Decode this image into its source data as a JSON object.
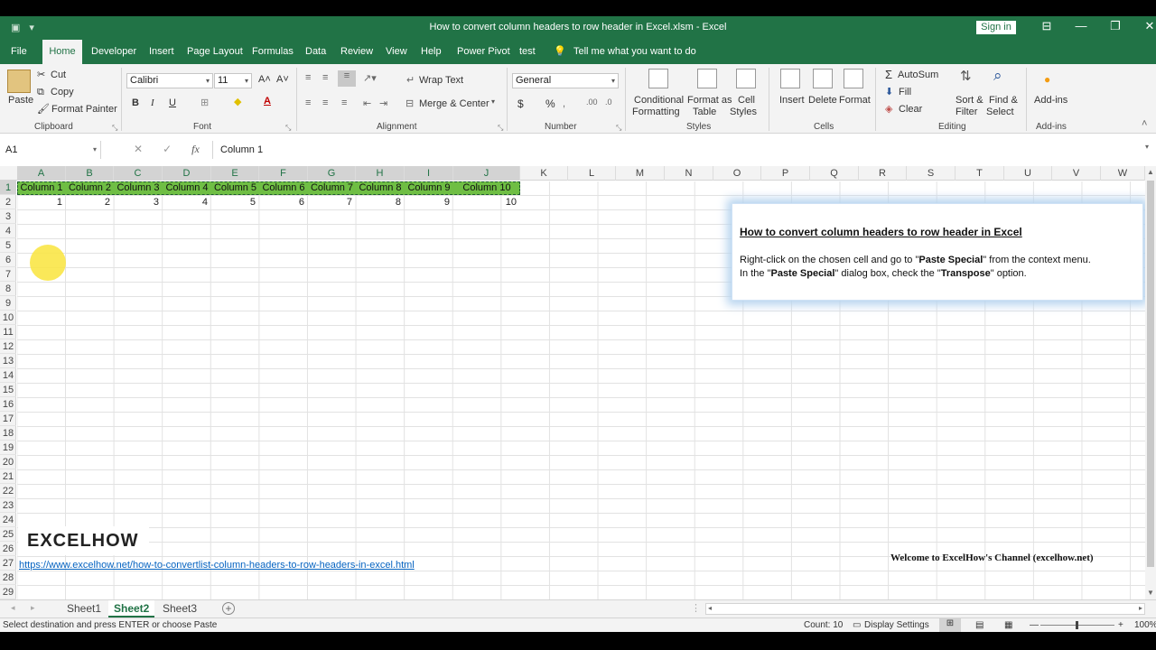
{
  "window": {
    "title": "How to convert column headers to row header in Excel.xlsm  -  Excel",
    "sign_in": "Sign in",
    "min": "—",
    "restore": "❐",
    "close": "✕"
  },
  "tabs": [
    "File",
    "Home",
    "Developer",
    "Insert",
    "Page Layout",
    "Formulas",
    "Data",
    "Review",
    "View",
    "Help",
    "Power Pivot",
    "test"
  ],
  "tell_me": "Tell me what you want to do",
  "ribbon": {
    "clipboard": {
      "label": "Clipboard",
      "paste": "Paste",
      "cut": "Cut",
      "copy": "Copy",
      "format_painter": "Format Painter"
    },
    "font": {
      "label": "Font",
      "name": "Calibri",
      "size": "11",
      "bold": "B",
      "italic": "I",
      "underline": "U"
    },
    "alignment": {
      "label": "Alignment",
      "wrap_text": "Wrap Text",
      "merge_center": "Merge & Center"
    },
    "number": {
      "label": "Number",
      "format": "General",
      "currency": "$",
      "percent": "%"
    },
    "styles": {
      "label": "Styles",
      "conditional_1": "Conditional",
      "conditional_2": "Formatting",
      "format_as_1": "Format as",
      "format_as_2": "Table",
      "cell_1": "Cell",
      "cell_2": "Styles"
    },
    "cells": {
      "label": "Cells",
      "insert": "Insert",
      "delete": "Delete",
      "format": "Format"
    },
    "editing": {
      "label": "Editing",
      "autosum": "AutoSum",
      "fill": "Fill",
      "clear": "Clear",
      "sort_1": "Sort &",
      "sort_2": "Filter",
      "find_1": "Find &",
      "find_2": "Select"
    },
    "addins": {
      "label": "Add-ins",
      "addins": "Add-ins"
    }
  },
  "formula_bar": {
    "name_box": "A1",
    "cancel": "✕",
    "enter": "✓",
    "fx": "fx",
    "value": "Column 1"
  },
  "columns": [
    "A",
    "B",
    "C",
    "D",
    "E",
    "F",
    "G",
    "H",
    "I",
    "J",
    "K",
    "L",
    "M",
    "N",
    "O",
    "P",
    "Q",
    "R",
    "S",
    "T",
    "U",
    "V",
    "W"
  ],
  "rows": [
    "1",
    "2",
    "3",
    "4",
    "5",
    "6",
    "7",
    "8",
    "9",
    "10",
    "11",
    "12",
    "13",
    "14",
    "15",
    "16",
    "17",
    "18",
    "19",
    "20",
    "21",
    "22",
    "23",
    "24",
    "25",
    "26",
    "27",
    "28",
    "29"
  ],
  "header_cells": [
    "Column 1",
    "Column 2",
    "Column 3",
    "Column 4",
    "Column 5",
    "Column 6",
    "Column 7",
    "Column 8",
    "Column 9",
    "Column 10"
  ],
  "value_cells": [
    "1",
    "2",
    "3",
    "4",
    "5",
    "6",
    "7",
    "8",
    "9",
    "10"
  ],
  "info_box": {
    "title": "How to convert column headers to row header in Excel",
    "l1a": "Right-click on the chosen cell and go to \"",
    "l1b": "Paste Special",
    "l1c": "\" from the context menu.",
    "l2a": "In the \"",
    "l2b": "Paste Special",
    "l2c": "\" dialog box, check the \"",
    "l2d": "Transpose",
    "l2e": "\" option."
  },
  "brand": "EXCELHOW",
  "link": "https://www.excelhow.net/how-to-convertlist-column-headers-to-row-headers-in-excel.html",
  "welcome": "Welcome to ExcelHow's  Channel (excelhow.net)",
  "sheets": [
    "Sheet1",
    "Sheet2",
    "Sheet3"
  ],
  "add_sheet": "+",
  "status": {
    "message": "Select destination and press ENTER or choose Paste",
    "count": "Count: 10",
    "display_settings": "Display Settings",
    "zoom": "100%"
  },
  "colors": {
    "accent": "#217346",
    "header_fill": "#6fbe44",
    "link": "#0563c1"
  }
}
